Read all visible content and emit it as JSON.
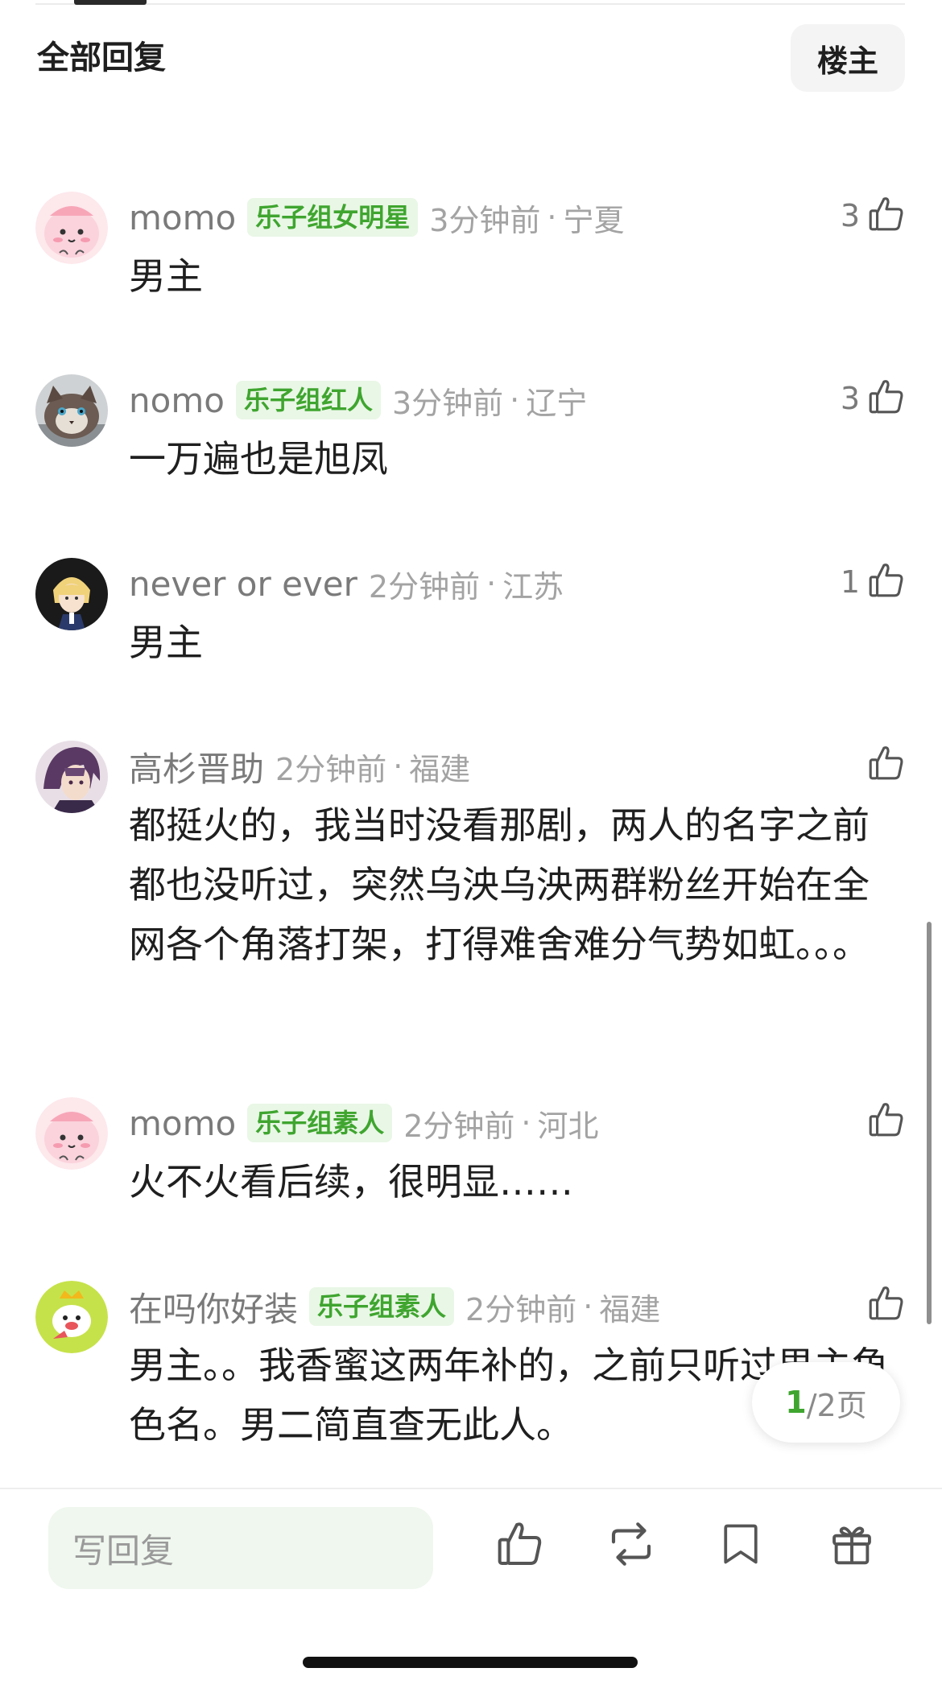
{
  "header": {
    "title": "全部回复",
    "op_filter_label": "楼主"
  },
  "comments": [
    {
      "username": "momo",
      "badge": "乐子组女明星",
      "time": "3分钟前",
      "location": "宁夏",
      "likes": "3",
      "text": "男主",
      "avatar": "pink-blob-avatar"
    },
    {
      "username": "nomo",
      "badge": "乐子组红人",
      "time": "3分钟前",
      "location": "辽宁",
      "likes": "3",
      "text": "一万遍也是旭凤",
      "avatar": "cat-avatar"
    },
    {
      "username": "never or ever",
      "badge": "",
      "time": "2分钟前",
      "location": "江苏",
      "likes": "1",
      "text": "男主",
      "avatar": "anime-blonde-avatar"
    },
    {
      "username": "高杉晋助",
      "badge": "",
      "time": "2分钟前",
      "location": "福建",
      "likes": "",
      "text": "都挺火的，我当时没看那剧，两人的名字之前都也没听过，突然乌泱乌泱两群粉丝开始在全网各个角落打架，打得难舍难分气势如虹。。。",
      "avatar": "anime-purple-hair-avatar"
    },
    {
      "username": "momo",
      "badge": "乐子组素人",
      "time": "2分钟前",
      "location": "河北",
      "likes": "",
      "text": "火不火看后续，很明显……",
      "avatar": "pink-blob-avatar"
    },
    {
      "username": "在吗你好装",
      "badge": "乐子组素人",
      "time": "2分钟前",
      "location": "福建",
      "likes": "",
      "text": "男主。。我香蜜这两年补的，之前只听过男主角色名。男二简直查无此人。",
      "avatar": "cartoon-crown-avatar"
    }
  ],
  "separator": "·",
  "pagination": {
    "current": "1",
    "rest": "/2页"
  },
  "bottom_bar": {
    "reply_placeholder": "写回复",
    "icons": [
      "thumbs-up-icon",
      "repost-icon",
      "bookmark-icon",
      "gift-icon"
    ]
  },
  "colors": {
    "accent_green": "#3fa52f",
    "badge_bg": "#e9f7e6",
    "reply_bg": "#eff7ee"
  }
}
